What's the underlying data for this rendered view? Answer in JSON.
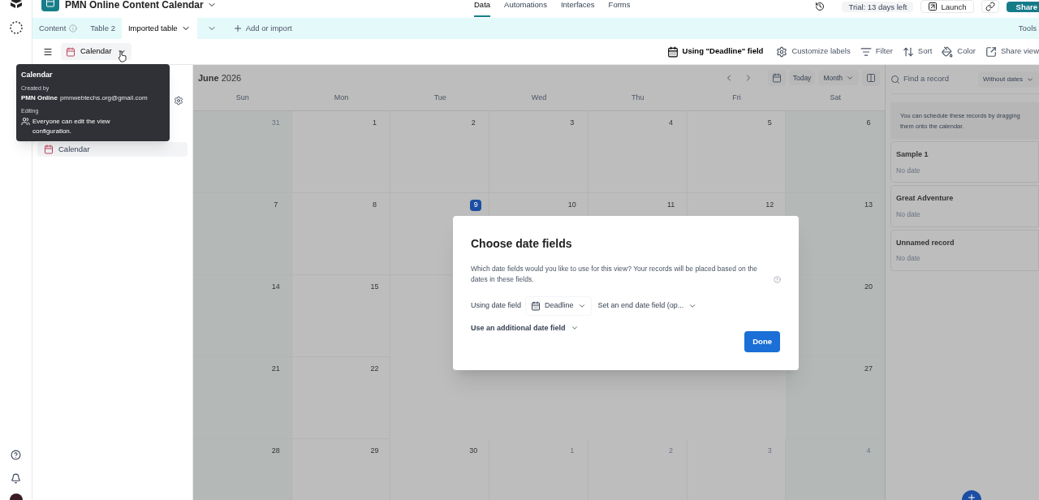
{
  "base": {
    "title": "PMN Online Content Calendar"
  },
  "nav_tabs": [
    {
      "label": "Data",
      "selected": true
    },
    {
      "label": "Automations",
      "selected": false
    },
    {
      "label": "Interfaces",
      "selected": false
    },
    {
      "label": "Forms",
      "selected": false
    }
  ],
  "header_actions": {
    "trial": "Trial: 13 days left",
    "launch": "Launch",
    "share": "Share"
  },
  "table_tabs": [
    {
      "label": "Content",
      "selected": false,
      "info": true
    },
    {
      "label": "Table 2",
      "selected": false,
      "info": false
    },
    {
      "label": "Imported table",
      "selected": true,
      "info": false
    }
  ],
  "add_table": "Add or import",
  "tools": "Tools",
  "view": {
    "name": "Calendar"
  },
  "toolbar": [
    {
      "kind": "date_field",
      "label": "Using \"Deadline\" field"
    },
    {
      "kind": "labels",
      "label": "Customize labels"
    },
    {
      "kind": "filter",
      "label": "Filter"
    },
    {
      "kind": "sort",
      "label": "Sort"
    },
    {
      "kind": "color",
      "label": "Color"
    },
    {
      "kind": "share",
      "label": "Share view"
    }
  ],
  "tooltip": {
    "title": "Calendar",
    "created_by_label": "Created by",
    "creator_name": "PMN Online",
    "creator_email": "pmnwebtechs.org@gmail.com",
    "editing_label": "Editing",
    "editing_text": "Everyone can edit the view configuration."
  },
  "sidebar_items": [
    {
      "label": "Calendar"
    }
  ],
  "calendar": {
    "month": "June",
    "year": "2026",
    "today_label": "Today",
    "range": "Month",
    "weekdays": [
      "Sun",
      "Mon",
      "Tue",
      "Wed",
      "Thu",
      "Fri",
      "Sat"
    ],
    "weeks": [
      {
        "left": [
          {
            "day": "31",
            "outside": true,
            "today": false
          },
          {
            "day": "1",
            "outside": false,
            "today": false
          },
          {
            "day": "2",
            "outside": false,
            "today": false
          },
          {
            "day": "3",
            "outside": false,
            "today": false
          },
          {
            "day": "4",
            "outside": false,
            "today": false
          },
          {
            "day": "5",
            "outside": false,
            "today": false
          },
          {
            "day": "6",
            "outside": false,
            "today": false
          }
        ]
      },
      {
        "left": [
          {
            "day": "7",
            "outside": false,
            "today": false
          },
          {
            "day": "8",
            "outside": false,
            "today": false
          },
          {
            "day": "9",
            "outside": false,
            "today": true
          },
          {
            "day": "10",
            "outside": false,
            "today": false
          },
          {
            "day": "11",
            "outside": false,
            "today": false
          },
          {
            "day": "12",
            "outside": false,
            "today": false
          },
          {
            "day": "13",
            "outside": false,
            "today": false
          }
        ]
      },
      {
        "left": [
          {
            "day": "14",
            "outside": false,
            "today": false
          },
          {
            "day": "15",
            "outside": false,
            "today": false
          }
        ],
        "right": [
          {
            "day": "20",
            "outside": false,
            "today": false
          }
        ]
      },
      {
        "left": [
          {
            "day": "21",
            "outside": false,
            "today": false
          },
          {
            "day": "22",
            "outside": false,
            "today": false
          }
        ],
        "right": [
          {
            "day": "27",
            "outside": false,
            "today": false
          }
        ]
      },
      {
        "left": [
          {
            "day": "28",
            "outside": false,
            "today": false
          },
          {
            "day": "29",
            "outside": false,
            "today": false
          },
          {
            "day": "30",
            "outside": false,
            "today": false
          },
          {
            "day": "1",
            "outside": true,
            "today": false
          },
          {
            "day": "2",
            "outside": true,
            "today": false
          },
          {
            "day": "3",
            "outside": true,
            "today": false
          },
          {
            "day": "4",
            "outside": true,
            "today": false
          }
        ]
      }
    ]
  },
  "records_panel": {
    "search_placeholder": "Find a record",
    "filter": "Without dates",
    "hint": "You can schedule these records by dragging them onto the calendar.",
    "records": [
      {
        "name": "Sample 1",
        "date": "No date"
      },
      {
        "name": "Great Adventure",
        "date": "No date"
      },
      {
        "name": "Unnamed record",
        "date": "No date"
      }
    ]
  },
  "dialog": {
    "title": "Choose date fields",
    "description": "Which date fields would you like to use for this view? Your records will be placed based on the dates in these fields.",
    "using_label": "Using date field",
    "start_field": "Deadline",
    "end_field": "Set an end date field (op...",
    "additional": "Use an additional date field",
    "done": "Done"
  }
}
